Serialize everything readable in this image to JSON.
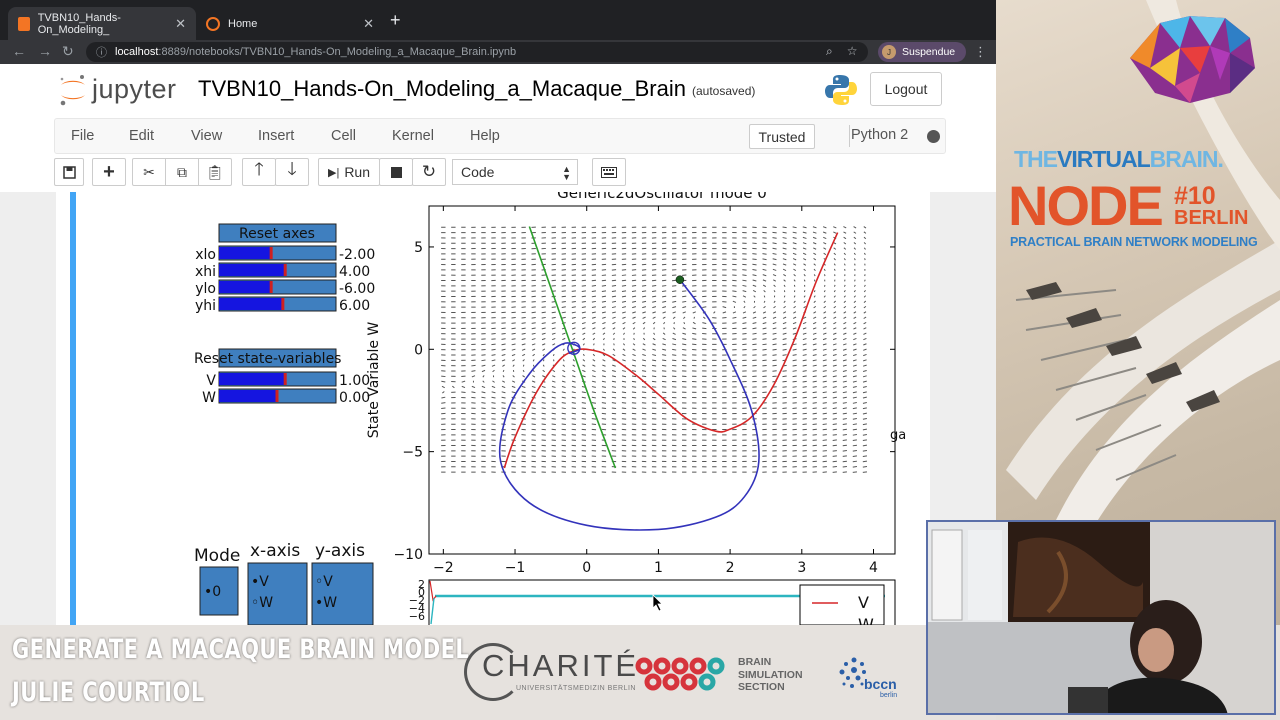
{
  "browser": {
    "tabs": [
      {
        "label": "TVBN10_Hands-On_Modeling_",
        "active": true
      },
      {
        "label": "Home",
        "active": false
      }
    ],
    "url_host": "localhost",
    "url_path": ":8889/notebooks/TVBN10_Hands-On_Modeling_a_Macaque_Brain.ipynb",
    "profile_initial": "J",
    "profile_label": "Suspendue"
  },
  "jupyter": {
    "brand": "jupyter",
    "notebook_title": "TVBN10_Hands-On_Modeling_a_Macaque_Brain",
    "autosave": "(autosaved)",
    "logout": "Logout",
    "menu": [
      "File",
      "Edit",
      "View",
      "Insert",
      "Cell",
      "Kernel",
      "Help"
    ],
    "trusted": "Trusted",
    "kernel": "Python 2",
    "toolbar": {
      "run": "Run",
      "cell_type": "Code"
    }
  },
  "widgets": {
    "reset_axes": "Reset axes",
    "sliders": [
      {
        "label": "xlo",
        "value": "-2.00",
        "fill": 0.45
      },
      {
        "label": "xhi",
        "value": "4.00",
        "fill": 0.57
      },
      {
        "label": "ylo",
        "value": "-6.00",
        "fill": 0.45
      },
      {
        "label": "yhi",
        "value": "6.00",
        "fill": 0.55
      }
    ],
    "reset_state": "Reset state-variables",
    "state_sliders": [
      {
        "label": "V",
        "value": "1.00",
        "fill": 0.57
      },
      {
        "label": "W",
        "value": "0.00",
        "fill": 0.5
      }
    ],
    "mode_label": "Mode",
    "mode_value": "0",
    "xaxis_label": "x-axis",
    "yaxis_label": "y-axis",
    "radio_options": [
      "V",
      "W"
    ],
    "side_label": "ga"
  },
  "chart_data": [
    {
      "type": "line",
      "title": "Generic2dOscillator mode 0",
      "xlabel": "",
      "ylabel": "State Variable W",
      "xlim": [
        -2.2,
        4.3
      ],
      "ylim": [
        -10,
        7
      ],
      "xticks": [
        -2,
        -1,
        0,
        1,
        2,
        3,
        4
      ],
      "yticks": [
        5,
        0,
        -5,
        -10
      ],
      "vector_field": {
        "x_range": [
          -2,
          4
        ],
        "y_range": [
          -6,
          6
        ],
        "shown": true
      },
      "series": [
        {
          "name": "",
          "role": "V-nullcline",
          "color": "#d62728",
          "x": [
            -1.15,
            -1.0,
            -0.7,
            -0.4,
            -0.2,
            0.0,
            0.3,
            0.7,
            1.0,
            1.4,
            1.8,
            2.0,
            2.3,
            2.6,
            2.9,
            3.2,
            3.5
          ],
          "y": [
            -5.8,
            -4.3,
            -2.1,
            -0.6,
            -0.1,
            0.0,
            -0.3,
            -1.3,
            -2.2,
            -3.4,
            -4.0,
            -3.9,
            -3.3,
            -1.8,
            0.5,
            3.3,
            5.7
          ]
        },
        {
          "name": "",
          "role": "W-nullcline",
          "color": "#2ca02c",
          "x": [
            -0.8,
            -0.5,
            -0.2,
            0.1,
            0.4
          ],
          "y": [
            6.0,
            3.0,
            0.0,
            -3.0,
            -5.8
          ]
        },
        {
          "name": "",
          "role": "trajectory",
          "color": "#3333bb",
          "x": [
            1.3,
            1.7,
            2.0,
            2.3,
            2.4,
            2.2,
            1.8,
            1.0,
            0.0,
            -0.8,
            -1.2,
            -1.1,
            -0.8,
            -0.5,
            -0.3,
            -0.15,
            -0.1,
            -0.25
          ],
          "y": [
            3.4,
            1.5,
            -0.5,
            -3.0,
            -5.5,
            -7.2,
            -8.2,
            -8.8,
            -8.6,
            -7.5,
            -5.5,
            -3.0,
            -1.2,
            -0.1,
            0.3,
            0.2,
            0.0,
            -0.2
          ]
        },
        {
          "name": "",
          "role": "start-point",
          "color": "#1b5e20",
          "x": [
            1.3
          ],
          "y": [
            3.4
          ]
        }
      ]
    },
    {
      "type": "line",
      "title": "",
      "yticks": [
        "2",
        "0",
        "-2",
        "-4",
        "-6"
      ],
      "legend": [
        "V",
        "W"
      ],
      "legend_position": "right",
      "series": [
        {
          "name": "V",
          "color": "#d62728"
        },
        {
          "name": "W",
          "color": "#2cb5c0"
        }
      ]
    }
  ],
  "conference": {
    "tvb_part1": "THE",
    "tvb_part2": "VIRTUAL",
    "tvb_part3": "BRAIN.",
    "node": "NODE",
    "node_number": "#10",
    "city": "BERLIN",
    "subtitle": "PRACTICAL BRAIN NETWORK MODELING"
  },
  "lower_third": {
    "line1": "GENERATE A MACAQUE BRAIN MODEL",
    "line2": "JULIE COURTIOL"
  },
  "sponsors": {
    "charite": "CHARITÉ",
    "charite_sub": "UNIVERSITÄTSMEDIZIN BERLIN",
    "bss": [
      "BRAIN",
      "SIMULATION",
      "SECTION"
    ],
    "bccn": "bccn",
    "bccn_sub": "berlin"
  }
}
